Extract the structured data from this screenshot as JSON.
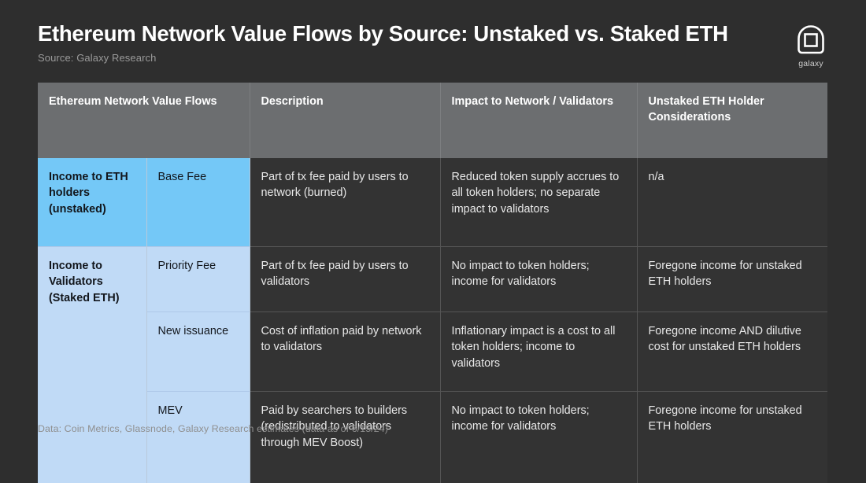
{
  "header": {
    "title": "Ethereum Network Value Flows by Source: Unstaked vs. Staked ETH",
    "subtitle": "Source: Galaxy Research"
  },
  "logo": {
    "wordmark": "galaxy",
    "mark_name": "galaxy-logo-mark"
  },
  "table": {
    "columns": [
      "Ethereum Network Value Flows",
      "Description",
      "Impact to Network / Validators",
      "Unstaked ETH Holder Considerations"
    ],
    "rows": [
      {
        "category": "Income to ETH holders (unstaked)",
        "subcategory": "Base Fee",
        "description": "Part   of tx fee paid by users to network (burned)",
        "impact": "Reduced token supply accrues to all token holders; no separate impact to validators",
        "consideration": "n/a",
        "accent": "#74c8f7"
      },
      {
        "category": "Income to Validators (Staked ETH)",
        "subcategory": "Priority Fee",
        "description": "Part   of tx fee paid by users to validators",
        "impact": "No impact to token holders; income for validators",
        "consideration": "Foregone income for unstaked ETH holders",
        "accent": "#c0daf6"
      },
      {
        "category": "",
        "subcategory": "New issuance",
        "description": "Cost   of inflation paid by network to validators",
        "impact": "Inflationary impact is a cost to all token holders; income to validators",
        "consideration": "Foregone income AND dilutive cost for unstaked ETH holders",
        "accent": "#c0daf6"
      },
      {
        "category": "",
        "subcategory": "MEV",
        "description": "Paid   by searchers to builders (redistributed to validators through MEV Boost)",
        "impact": "No impact to token holders; income for validators",
        "consideration": "Foregone income for unstaked ETH holders",
        "accent": "#c0daf6"
      }
    ]
  },
  "footer": {
    "note": "Data: Coin Metrics, Glassnode, Galaxy Research estimates (data as of 6/15/24)"
  },
  "colors": {
    "background": "#2e2e2e",
    "header_row": "#6c6e70",
    "cell_background": "#333333",
    "accent_bright": "#74c8f7",
    "accent_pale": "#c0daf6",
    "text_primary": "#ffffff",
    "text_muted": "#9a9a9a"
  }
}
